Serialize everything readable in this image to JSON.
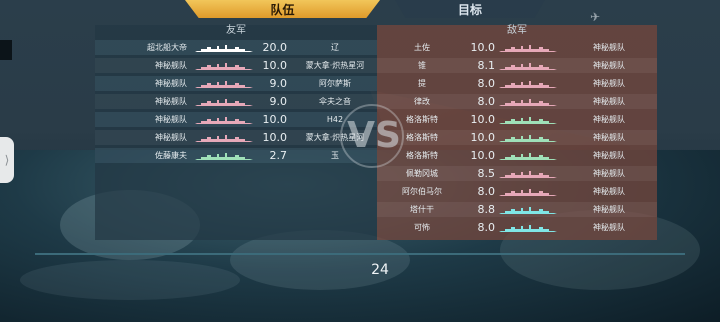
{
  "tabs": {
    "team": "队伍",
    "target": "目标"
  },
  "friendly": {
    "header": "友军",
    "rows": [
      {
        "name": "超北船大帝",
        "score": "20.0",
        "ship": "辽",
        "color": "#ffffff"
      },
      {
        "name": "神秘舰队",
        "score": "10.0",
        "ship": "蒙大拿·炽热星河",
        "color": "#e6a8b8"
      },
      {
        "name": "神秘舰队",
        "score": "9.0",
        "ship": "阿尔萨斯",
        "color": "#e6a8b8"
      },
      {
        "name": "神秘舰队",
        "score": "9.0",
        "ship": "伞夫之音",
        "color": "#e6a8b8"
      },
      {
        "name": "神秘舰队",
        "score": "10.0",
        "ship": "H42",
        "color": "#e6a8b8"
      },
      {
        "name": "神秘舰队",
        "score": "10.0",
        "ship": "蒙大拿·炽热星河",
        "color": "#e6a8b8"
      },
      {
        "name": "佐藤康夫",
        "score": "2.7",
        "ship": "玉",
        "color": "#9fe0b8"
      }
    ]
  },
  "enemy": {
    "header": "敌军",
    "rows": [
      {
        "ship": "土佐",
        "score": "10.0",
        "name": "神秘舰队",
        "color": "#e6a8b8"
      },
      {
        "ship": "锥",
        "score": "8.1",
        "name": "神秘舰队",
        "color": "#e6a8b8"
      },
      {
        "ship": "提",
        "score": "8.0",
        "name": "神秘舰队",
        "color": "#e6a8b8"
      },
      {
        "ship": "律改",
        "score": "8.0",
        "name": "神秘舰队",
        "color": "#e6a8b8"
      },
      {
        "ship": "格洛斯特",
        "score": "10.0",
        "name": "神秘舰队",
        "color": "#9fe0b8"
      },
      {
        "ship": "格洛斯特",
        "score": "10.0",
        "name": "神秘舰队",
        "color": "#9fe0b8"
      },
      {
        "ship": "格洛斯特",
        "score": "10.0",
        "name": "神秘舰队",
        "color": "#9fe0b8"
      },
      {
        "ship": "佩勒冈城",
        "score": "8.5",
        "name": "神秘舰队",
        "color": "#e6a8b8"
      },
      {
        "ship": "阿尔伯马尔",
        "score": "8.0",
        "name": "神秘舰队",
        "color": "#e6a8b8"
      },
      {
        "ship": "塔什干",
        "score": "8.8",
        "name": "神秘舰队",
        "color": "#7fe6e6"
      },
      {
        "ship": "可怖",
        "score": "8.0",
        "name": "神秘舰队",
        "color": "#7fe6e6"
      }
    ]
  },
  "vs_label": "VS",
  "timer": "24"
}
